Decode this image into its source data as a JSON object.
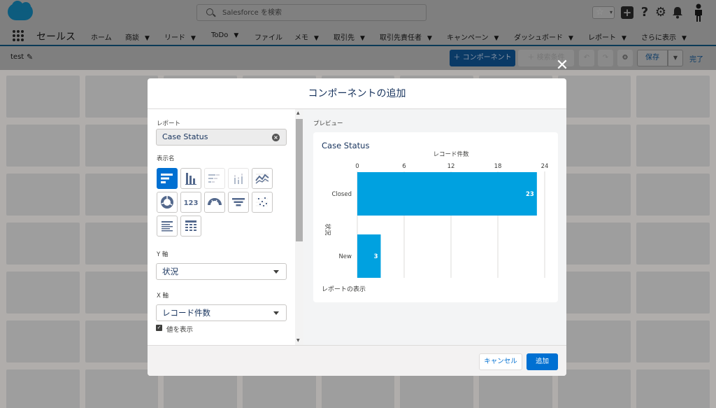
{
  "header": {
    "search_placeholder": "Salesforce を検索",
    "app_name": "セールス",
    "nav_items": [
      {
        "label": "ホーム",
        "dropdown": false
      },
      {
        "label": "商談",
        "dropdown": true
      },
      {
        "label": "リード",
        "dropdown": true
      },
      {
        "label": "ToDo",
        "dropdown": true
      },
      {
        "label": "ファイル",
        "dropdown": false
      },
      {
        "label": "メモ",
        "dropdown": true
      },
      {
        "label": "取引先",
        "dropdown": true
      },
      {
        "label": "取引先責任者",
        "dropdown": true
      },
      {
        "label": "キャンペーン",
        "dropdown": true
      },
      {
        "label": "ダッシュボード",
        "dropdown": true
      },
      {
        "label": "レポート",
        "dropdown": true
      },
      {
        "label": "さらに表示",
        "dropdown": true
      }
    ],
    "icons": [
      "favorite-star-icon",
      "global-add-icon",
      "help-icon",
      "setup-gear-icon",
      "notification-bell-icon",
      "user-avatar-icon"
    ]
  },
  "toolbar": {
    "page_name": "test",
    "add_component": "＋ コンポーネント",
    "add_filter": "＋ 検索条件",
    "save": "保存",
    "done": "完了"
  },
  "modal": {
    "title": "コンポーネントの追加",
    "report_label": "レポート",
    "report_value": "Case Status",
    "display_label": "表示名",
    "y_axis_label": "Y 軸",
    "y_axis_value": "状況",
    "x_axis_label": "X 軸",
    "x_axis_value": "レコード件数",
    "show_values_label": "値を表示",
    "show_values_checked": true,
    "preview_label": "プレビュー",
    "cancel": "キャンセル",
    "add": "追加",
    "visual_types": [
      "horizontal-bar",
      "vertical-bar",
      "stacked-horizontal-bar",
      "stacked-vertical-bar",
      "line",
      "donut",
      "metric",
      "gauge",
      "funnel",
      "scatter",
      "lightning-table",
      "table"
    ],
    "selected_visual": "horizontal-bar"
  },
  "preview": {
    "title": "Case Status",
    "view_report": "レポートの表示"
  },
  "chart_data": {
    "type": "bar",
    "orientation": "horizontal",
    "title": "Case Status",
    "xlabel": "レコード件数",
    "ylabel": "状況",
    "categories": [
      "Closed",
      "New"
    ],
    "values": [
      23,
      3
    ],
    "xlim": [
      0,
      24
    ],
    "ticks": [
      0,
      6,
      12,
      18,
      24
    ],
    "data_labels": true,
    "bar_color": "#00a1e0",
    "grid": true
  },
  "colors": {
    "brand": "#0070d2",
    "bar": "#00a1e0"
  }
}
